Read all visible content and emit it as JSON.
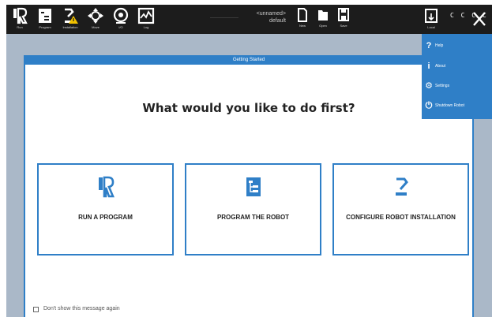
{
  "toolbar": {
    "run_label": "Run",
    "program_label": "Program",
    "installation_label": "Installation",
    "move_label": "Move",
    "io_label": "I/O",
    "log_label": "Log",
    "program_name": "<unnamed>",
    "installation_name": "default",
    "new_label": "New",
    "open_label": "Open",
    "save_label": "Save",
    "local_label": "Local",
    "cc_label": "C C C C",
    "icons": [
      "ur-logo-icon",
      "program-icon",
      "installation-icon",
      "move-icon",
      "io-icon",
      "log-icon",
      "new-file-icon",
      "open-folder-icon",
      "save-icon",
      "local-icon",
      "close-icon"
    ]
  },
  "menu": {
    "items": [
      {
        "icon": "?",
        "icon_name": "help-icon",
        "label": "Help"
      },
      {
        "icon": "i",
        "icon_name": "about-icon",
        "label": "About"
      },
      {
        "icon": "⚙",
        "icon_name": "settings-icon",
        "label": "Settings"
      },
      {
        "icon": "⏻",
        "icon_name": "power-icon",
        "label": "Shutdown Robot"
      }
    ]
  },
  "dialog": {
    "title": "Getting Started",
    "question": "What would you like to do first?",
    "cards": [
      {
        "label": "RUN A PROGRAM",
        "icon_name": "ur-logo-icon"
      },
      {
        "label": "PROGRAM THE ROBOT",
        "icon_name": "program-icon"
      },
      {
        "label": "CONFIGURE ROBOT INSTALLATION",
        "icon_name": "robot-arm-icon"
      }
    ],
    "dont_show_label": "Don't show this message again",
    "dont_show_checked": false
  },
  "colors": {
    "accent": "#2f7fc7",
    "toolbar_bg": "#1c1c1c",
    "backdrop": "#aab8c8",
    "warning": "#f2c200"
  }
}
